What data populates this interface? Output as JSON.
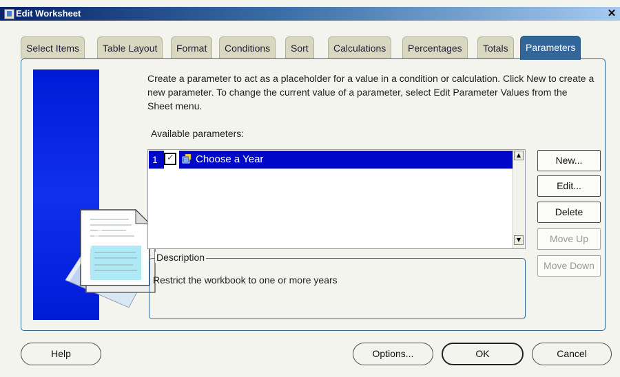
{
  "window": {
    "title": "Edit Worksheet",
    "close_glyph": "✕"
  },
  "tabs": [
    {
      "label": "Select Items"
    },
    {
      "label": "Table Layout"
    },
    {
      "label": "Format"
    },
    {
      "label": "Conditions"
    },
    {
      "label": "Sort"
    },
    {
      "label": "Calculations"
    },
    {
      "label": "Percentages"
    },
    {
      "label": "Totals"
    },
    {
      "label": "Parameters",
      "active": true
    }
  ],
  "main": {
    "instructions": "Create a parameter to act as a placeholder for a value in a condition or calculation.  Click New to create a new parameter.  To change the current value of a parameter, select Edit Parameter Values from the Sheet menu.",
    "available_label": "Available parameters:",
    "parameters": [
      {
        "index": "1",
        "checked": true,
        "name": "Choose a Year",
        "icon": "parameter-icon"
      }
    ],
    "description": {
      "legend": "Description",
      "text": "Restrict the workbook to one or more years"
    }
  },
  "side_buttons": {
    "new": "New...",
    "edit": "Edit...",
    "delete": "Delete",
    "move_up": "Move Up",
    "move_down": "Move Down"
  },
  "footer": {
    "help": "Help",
    "options": "Options...",
    "ok": "OK",
    "cancel": "Cancel"
  },
  "colors": {
    "accent": "#336699",
    "selection": "#0008c8",
    "sidebar": "#001bd6",
    "active_tab": "#336699"
  }
}
